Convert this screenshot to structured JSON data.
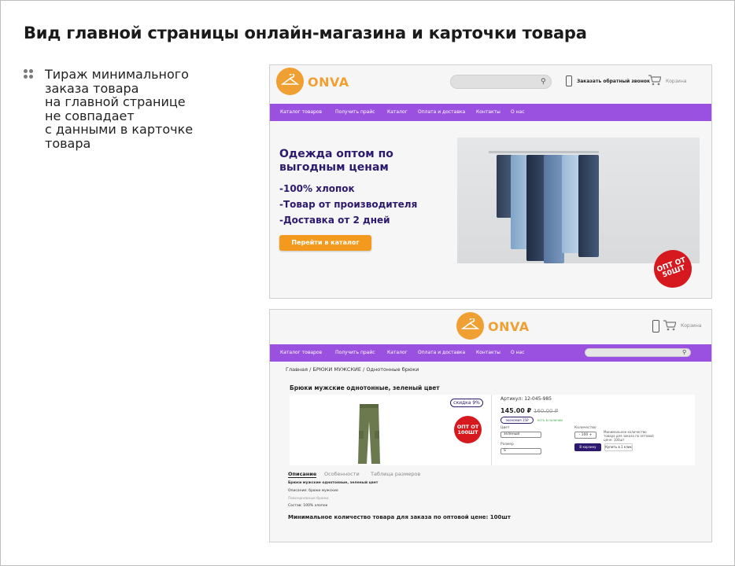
{
  "slide": {
    "title": "Вид главной страницы онлайн-магазина и карточки товара",
    "note": "Тираж минимального\nзаказа товара\nна главной странице\nне совпадает\nс данными в карточке\nтовара"
  },
  "home": {
    "logo": "ONVA",
    "search_placeholder": "",
    "callback_link": "Заказать обратный звонок",
    "cart_label": "Корзина",
    "nav": [
      "Каталог товаров",
      "Получить прайс",
      "Каталог",
      "Оплата и доставка",
      "Контакты",
      "О нас"
    ],
    "hero_title": "Одежда оптом по\nвыгодным ценам",
    "hero_lines": [
      "-100% хлопок",
      "-Товар от производителя",
      "-Доставка от 2 дней"
    ],
    "hero_button": "Перейти в каталог",
    "badge": "ОПТ ОТ 50ШТ"
  },
  "product_page": {
    "logo": "ONVA",
    "cart_label": "Корзина",
    "nav": [
      "Каталог товаров",
      "Получить прайс",
      "Каталог",
      "Оплата и доставка",
      "Контакты",
      "О нас"
    ],
    "breadcrumb": "Главная / БРЮКИ МУЖСКИЕ / Однотонные брюки",
    "title": "Брюки мужские однотонные, зеленый цвет",
    "discount": "скидка 9%",
    "badge": "ОПТ ОТ 100ШТ",
    "article": "Артикул: 12-045-985",
    "price": "145.00 ₽",
    "old_price": "160.00 ₽",
    "economy": "экономия 15₽",
    "in_stock": "есть в наличии",
    "color_label": "Цвет",
    "color_value": "зеленый",
    "size_label": "Размер",
    "size_value": "S",
    "qty_label": "Количество",
    "qty_value": "- 100 +",
    "qty_note": "Минимальное количество товара для заказа по оптовой цене: 100шт",
    "to_cart": "В корзину",
    "one_click": "Купить в 1 клик",
    "tabs": [
      "Описание",
      "Особенности",
      "Таблица размеров"
    ],
    "desc_line1": "Брюки мужские однотонные, зеленый цвет",
    "desc_line2": "Описание: брюки мужские",
    "desc_line3": "Повседневные брюки.",
    "desc_line4": "Состав: 100% хлопок",
    "min_order": "Минимальное количество товара для заказа по оптовой цене: 100шт"
  },
  "colors": {
    "accent": "#9b51e0",
    "brand": "#f0a033",
    "button": "#f39a1e",
    "badge": "#d6191e",
    "heading": "#2d1a6e"
  }
}
